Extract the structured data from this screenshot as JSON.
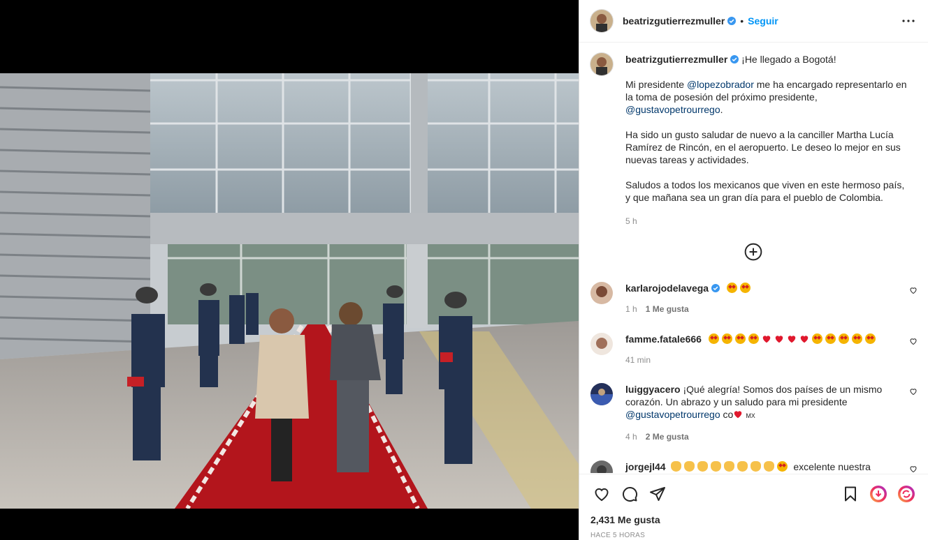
{
  "header": {
    "username": "beatrizgutierrezmuller",
    "separator": "•",
    "follow_label": "Seguir"
  },
  "caption": {
    "username": "beatrizgutierrezmuller",
    "lead": "¡He llegado a Bogotá!",
    "p1_a": "Mi presidente ",
    "p1_mention": "@lopezobrador",
    "p1_b": " me ha encargado representarlo en la toma de posesión del próximo presidente,",
    "p1_mention2": "@gustavopetrourrego",
    "p1_c": ".",
    "p2": "Ha sido un gusto saludar de nuevo a la canciller Martha Lucía Ramírez de Rincón, en el aeropuerto. Le deseo lo mejor en sus nuevas tareas y actividades.",
    "p3": "Saludos a todos los mexicanos que viven en este hermoso país, y que mañana sea un gran día para el pueblo de Colombia.",
    "time": "5 h"
  },
  "comments": [
    {
      "username": "karlarojodelavega",
      "verified": true,
      "time": "1 h",
      "likes": "1 Me gusta"
    },
    {
      "username": "famme.fatale666",
      "time": "41 min"
    },
    {
      "username": "luiggyacero",
      "text_a": "¡Qué alegría! Somos dos países de un mismo corazón. Un abrazo y un saludo para mi presidente ",
      "mention": "@gustavopetrourrego",
      "text_b": " co",
      "flag": "MX",
      "time": "4 h",
      "likes": "2 Me gusta"
    },
    {
      "username": "jorgejl44",
      "text": "excelente nuestra primera"
    }
  ],
  "actions": {
    "likes": "2,431 Me gusta",
    "posted": "HACE 5 HORAS"
  },
  "colors": {
    "accent": "#0095f6",
    "verified": "#3897f0",
    "carpet": "#b3151c"
  }
}
